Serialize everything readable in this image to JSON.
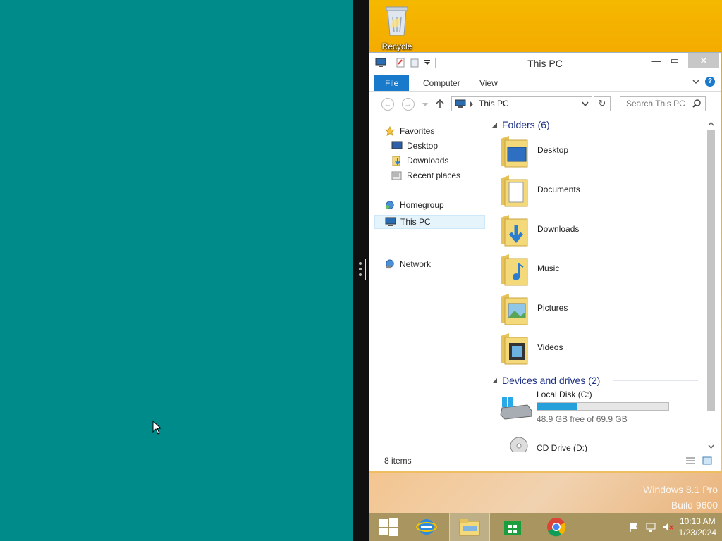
{
  "desktop": {
    "recycle_bin_label": "Recycle Bin",
    "watermark_line1": "Windows 8.1 Pro",
    "watermark_line2": "Build 9600"
  },
  "window": {
    "title": "This PC",
    "minimize_symbol": "—",
    "maximize_symbol": "▭",
    "close_symbol": "✕",
    "ribbon_tabs": [
      "File",
      "Computer",
      "View"
    ],
    "help_symbol": "?",
    "address": "This PC",
    "search_placeholder": "Search This PC"
  },
  "nav_pane": {
    "favorites": "Favorites",
    "favorites_items": [
      "Desktop",
      "Downloads",
      "Recent places"
    ],
    "homegroup": "Homegroup",
    "this_pc": "This PC",
    "network": "Network"
  },
  "content": {
    "folders_header": "Folders (6)",
    "folders": [
      "Desktop",
      "Documents",
      "Downloads",
      "Music",
      "Pictures",
      "Videos"
    ],
    "devices_header": "Devices and drives (2)",
    "drives": [
      {
        "name": "Local Disk (C:)",
        "free_text": "48.9 GB free of 69.9 GB",
        "used_fraction": 0.3
      },
      {
        "name": "CD Drive (D:)"
      }
    ]
  },
  "status": {
    "item_count": "8 items"
  },
  "taskbar": {
    "time": "10:13 AM",
    "date": "1/23/2024"
  },
  "colors": {
    "accent": "#1979ca",
    "teal_pane": "#008b8b",
    "drive_fill": "#26a0da"
  }
}
